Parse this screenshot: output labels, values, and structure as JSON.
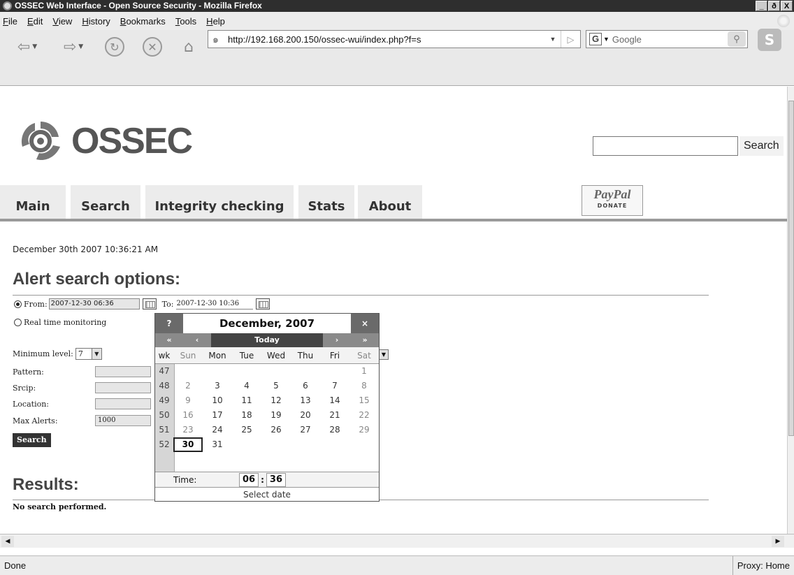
{
  "window": {
    "title": "OSSEC Web Interface - Open Source Security - Mozilla Firefox",
    "controls": [
      "_",
      "ð",
      "X"
    ]
  },
  "menu": [
    "File",
    "Edit",
    "View",
    "History",
    "Bookmarks",
    "Tools",
    "Help"
  ],
  "address_bar": {
    "url": "http://192.168.200.150/ossec-wui/index.php?f=s"
  },
  "search_bar": {
    "engine_letter": "G",
    "placeholder": "Google"
  },
  "header": {
    "logo_text": "OSSEC",
    "search_button": "Search",
    "search_value": ""
  },
  "tabs": [
    "Main",
    "Search",
    "Integrity checking",
    "Stats",
    "About"
  ],
  "donate": {
    "brand": "PayPal",
    "label": "DONATE"
  },
  "timestamp": "December 30th 2007 10:36:21 AM",
  "alert_search": {
    "heading": "Alert search options:",
    "from_label": "From:",
    "from_value": "2007-12-30 06:36",
    "to_label": "To:",
    "to_value": "2007-12-30 10:36",
    "realtime_label": "Real time monitoring",
    "min_level_label": "Minimum level:",
    "min_level_value": "7",
    "pattern_label": "Pattern:",
    "srcip_label": "Srcip:",
    "location_label": "Location:",
    "max_alerts_label": "Max Alerts:",
    "max_alerts_value": "1000",
    "search_button": "Search"
  },
  "calendar": {
    "help": "?",
    "month_title": "December, 2007",
    "close": "×",
    "prev_year": "«",
    "prev_month": "‹",
    "today": "Today",
    "next_month": "›",
    "next_year": "»",
    "week_header": "wk",
    "day_names": [
      "Sun",
      "Mon",
      "Tue",
      "Wed",
      "Thu",
      "Fri",
      "Sat"
    ],
    "weeks": [
      {
        "wk": "47",
        "days": [
          "",
          "",
          "",
          "",
          "",
          "",
          "1"
        ]
      },
      {
        "wk": "48",
        "days": [
          "2",
          "3",
          "4",
          "5",
          "6",
          "7",
          "8"
        ]
      },
      {
        "wk": "49",
        "days": [
          "9",
          "10",
          "11",
          "12",
          "13",
          "14",
          "15"
        ]
      },
      {
        "wk": "50",
        "days": [
          "16",
          "17",
          "18",
          "19",
          "20",
          "21",
          "22"
        ]
      },
      {
        "wk": "51",
        "days": [
          "23",
          "24",
          "25",
          "26",
          "27",
          "28",
          "29"
        ]
      },
      {
        "wk": "52",
        "days": [
          "30",
          "31",
          "",
          "",
          "",
          "",
          ""
        ]
      }
    ],
    "selected_day": "30",
    "time_label": "Time:",
    "hour": "06",
    "minute": "36",
    "footer": "Select date"
  },
  "results": {
    "heading": "Results:",
    "message": "No search performed."
  },
  "status": {
    "left": "Done",
    "right": "Proxy: Home"
  }
}
